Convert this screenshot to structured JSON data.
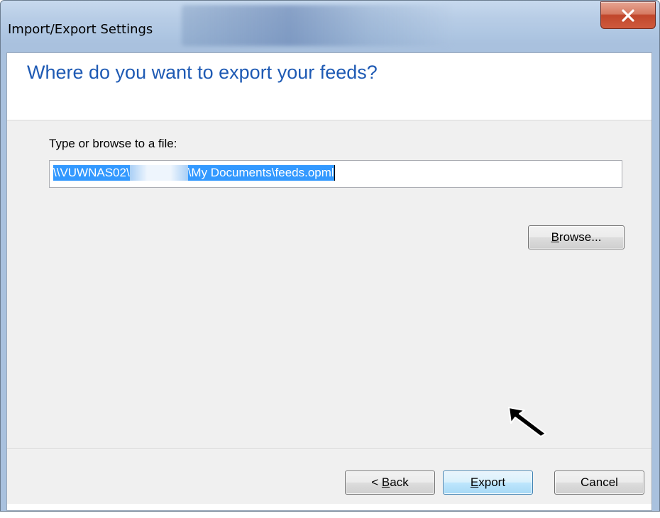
{
  "window": {
    "title": "Import/Export Settings",
    "close_glyph": "x"
  },
  "page": {
    "heading": "Where do you want to export your feeds?",
    "field_label": "Type or browse to a file:",
    "path_prefix": "\\\\VUWNAS02\\",
    "path_suffix": "\\My Documents\\feeds.opml"
  },
  "buttons": {
    "browse_mnemonic": "B",
    "browse_rest": "rowse...",
    "back_prefix": "< ",
    "back_mnemonic": "B",
    "back_rest": "ack",
    "export_mnemonic": "E",
    "export_rest": "xport",
    "cancel": "Cancel"
  },
  "colors": {
    "heading": "#1e5ab4",
    "selection": "#3399ff",
    "close_button": "#c0462b"
  }
}
